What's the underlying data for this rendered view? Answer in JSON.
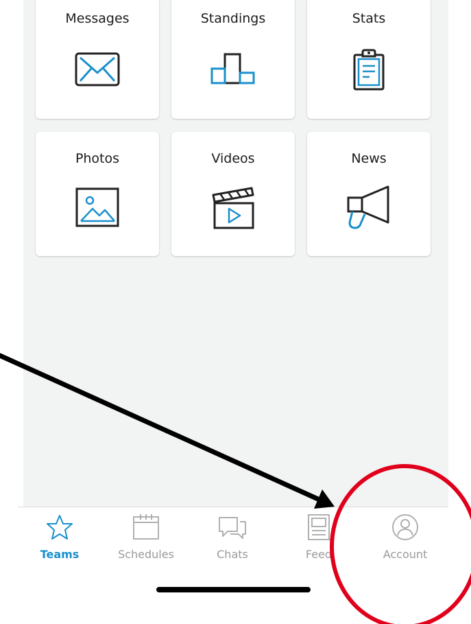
{
  "grid": {
    "tiles": [
      {
        "label": "Messages",
        "icon": "envelope-icon"
      },
      {
        "label": "Standings",
        "icon": "podium-icon"
      },
      {
        "label": "Stats",
        "icon": "clipboard-icon"
      },
      {
        "label": "Photos",
        "icon": "image-icon"
      },
      {
        "label": "Videos",
        "icon": "clapperboard-icon"
      },
      {
        "label": "News",
        "icon": "megaphone-icon"
      }
    ]
  },
  "tab_bar": {
    "tabs": [
      {
        "label": "Teams",
        "icon": "star-icon",
        "active": true
      },
      {
        "label": "Schedules",
        "icon": "calendar-icon",
        "active": false
      },
      {
        "label": "Chats",
        "icon": "chat-icon",
        "active": false
      },
      {
        "label": "Feed",
        "icon": "feed-icon",
        "active": false
      },
      {
        "label": "Account",
        "icon": "account-icon",
        "active": false
      }
    ]
  },
  "colors": {
    "accent": "#1a8fcc",
    "icon_dark": "#222222",
    "inactive": "#9a9a9a",
    "annotation_circle": "#e0001b",
    "annotation_arrow": "#000000"
  }
}
